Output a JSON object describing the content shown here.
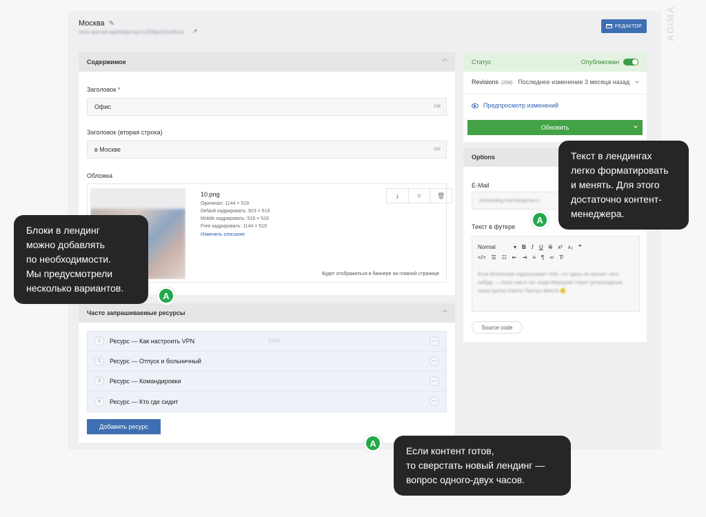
{
  "brand": "AGIMA",
  "header": {
    "city": "Москва",
    "url": "/ооо-аги-ма.agima/group.ru/Офис/moskva",
    "editor_label": "РЕДАКТОР"
  },
  "content_panel": {
    "title": "Содержимое",
    "title_field": {
      "label": "Заголовок",
      "required_mark": "*",
      "value": "Офис",
      "counter": "196"
    },
    "subtitle_field": {
      "label": "Заголовок (вторая строка)",
      "value": "в Москве",
      "counter": "192"
    },
    "cover": {
      "label": "Обложка",
      "file_name": "10.png",
      "original": "Оригинал: 1144 × 519",
      "default_crop": "Default кадрировать: 923 × 519",
      "mobile_crop": "Mobile кадрировать: 519 × 519",
      "free_crop": "Free кадрировать: 1144 × 519",
      "edit_description": "Изменить описание",
      "note": "Будет отображаться в баннере на главной странице"
    }
  },
  "resources_panel": {
    "title": "Часто запрашиваемые ресурсы",
    "items": [
      {
        "num": "1",
        "title": "Ресурс — Как настроить VPN"
      },
      {
        "num": "2",
        "title": "Ресурс — Отпуск и больничный"
      },
      {
        "num": "3",
        "title": "Ресурс — Командировки"
      },
      {
        "num": "4",
        "title": "Ресурс — Кто где сидит"
      }
    ],
    "add_label": "Добавить ресурс"
  },
  "status_panel": {
    "title": "Статус",
    "published_label": "Опубликован",
    "revisions_label": "Revisions",
    "revisions_count": "(208)",
    "last_change": "Последнее изменение 3 месяца назад",
    "preview_label": "Предпросмотр изменений",
    "update_label": "Обновить"
  },
  "options_panel": {
    "title": "Options",
    "email_label": "E-Mail",
    "email_value": "onboarding-team@agima.ru",
    "footer_label": "Текст в футере",
    "format_select": "Normal",
    "footer_text": "Если Вселенная подсказывает тебе, что здесь не хватает чего-нибудь — пиши нам в чат, когда Меркурий станет ретроградным, наша группа ответит быстро вместе 🙂",
    "source_code_label": "Source code"
  },
  "callouts": {
    "top_right": [
      "Текст в лендингах",
      "легко форматировать",
      "и менять. Для этого",
      "достаточно контент-",
      "менеджера."
    ],
    "left": [
      "Блоки в лендинг",
      "можно добавлять",
      "по необходимости.",
      "Мы предусмотрели",
      "несколько вариантов."
    ],
    "bottom": [
      "Если контент готов,",
      "то сверстать новый лендинг —",
      "вопрос одного-двух часов."
    ],
    "badge_letter": "A"
  },
  "colors": {
    "primary_blue": "#3e6fb2",
    "success_green": "#44a246",
    "status_bg": "#e3f2e1",
    "tooltip_bg": "#262626",
    "badge_green": "#23a84a"
  }
}
